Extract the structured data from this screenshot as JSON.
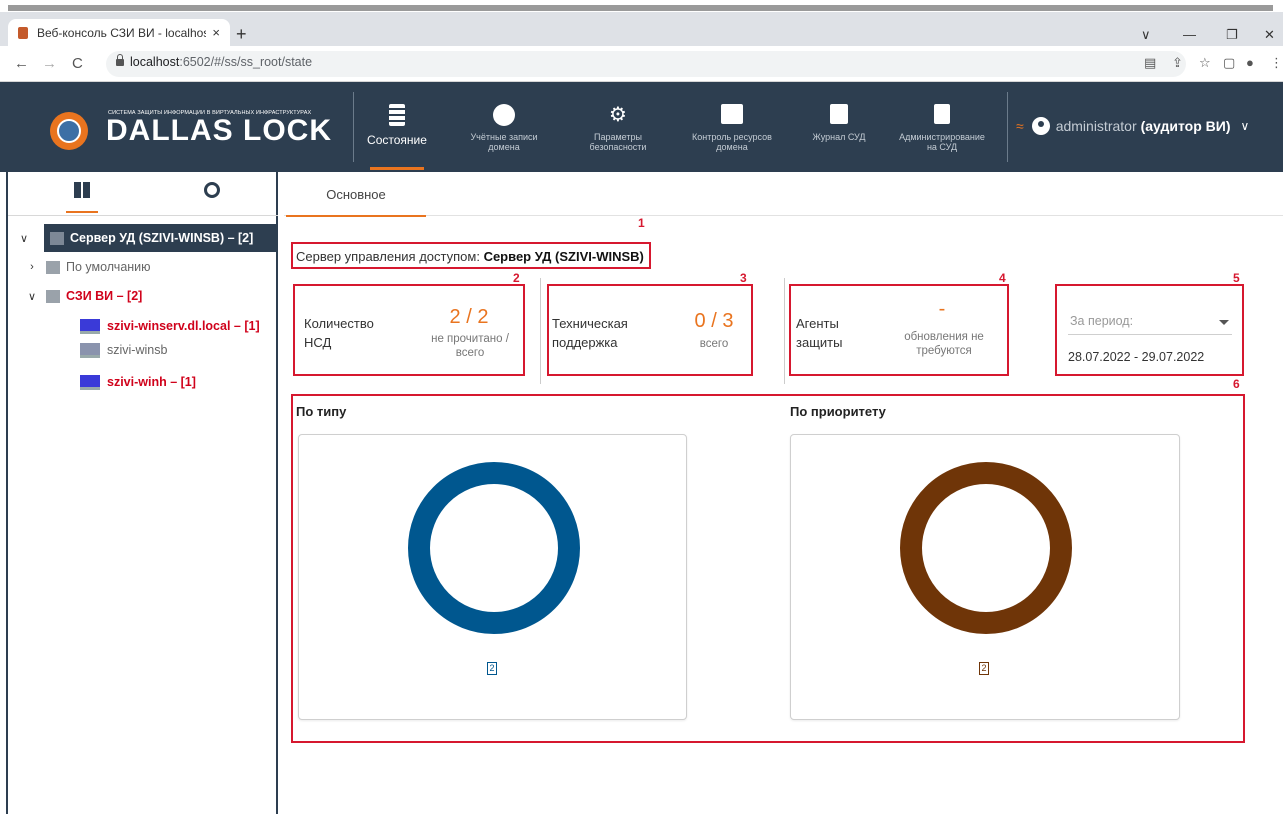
{
  "browser": {
    "tab_title": "Веб-консоль СЗИ ВИ - localhost",
    "tab_close": "×",
    "new_tab": "+",
    "url_host": "localhost",
    "url_path": ":6502/#/ss/ss_root/state",
    "back": "←",
    "forward": "→",
    "reload": "C",
    "window_controls": [
      "∨",
      "—",
      "❐",
      "✕"
    ],
    "toolbar_icons": [
      "translate-icon",
      "share-icon",
      "star-icon",
      "sidepanel-icon",
      "profile-icon",
      "menu-icon"
    ]
  },
  "app": {
    "logo_subtitle": "СИСТЕМА ЗАЩИТЫ ИНФОРМАЦИИ В ВИРТУАЛЬНЫХ ИНФРАСТРУКТУРАХ",
    "logo_title": "DALLAS LOCK",
    "nav": [
      {
        "label": "Состояние",
        "icon": "server-icon",
        "active": true
      },
      {
        "label": "Учётные записи домена",
        "icon": "user-circle-icon",
        "active": false
      },
      {
        "label": "Параметры безопасности",
        "icon": "gear-icon",
        "active": false
      },
      {
        "label": "Контроль ресурсов домена",
        "icon": "resources-icon",
        "active": false
      },
      {
        "label": "Журнал СУД",
        "icon": "journal-icon",
        "active": false
      },
      {
        "label": "Администрирование на СУД",
        "icon": "admin-icon",
        "active": false
      }
    ],
    "user_name": "administrator",
    "user_role": "(аудитор ВИ)",
    "accent_color": "#e9741f",
    "header_color": "#2d3e50"
  },
  "sidebar": {
    "tree": {
      "root": "Сервер УД (SZIVI-WINSB) – [2]",
      "groups": [
        {
          "label": "По умолчанию",
          "expanded": false
        },
        {
          "label": "СЗИ ВИ – [2]",
          "expanded": true,
          "children": [
            "szivi-winserv.dl.local – [1]",
            "szivi-winsb",
            "szivi-winh – [1]"
          ]
        }
      ]
    }
  },
  "main": {
    "tab": "Основное",
    "markers": [
      "1",
      "2",
      "3",
      "4",
      "5",
      "6"
    ],
    "server_label": "Сервер управления доступом:",
    "server_value": "Сервер УД (SZIVI-WINSB)",
    "cards": {
      "nsd_label": "Количество НСД",
      "nsd_value": "2 / 2",
      "nsd_sub": "не прочитано / всего",
      "support_label": "Техническая поддержка",
      "support_value": "0 / 3",
      "support_sub": "всего",
      "agents_label": "Агенты защиты",
      "agents_value": "-",
      "agents_sub": "обновления не требуются"
    },
    "period_placeholder": "За период:",
    "period_value": "28.07.2022 - 29.07.2022",
    "by_type_title": "По типу",
    "by_priority_title": "По приоритету",
    "by_type_legend": "2",
    "by_priority_legend": "2",
    "by_type_color": "#00578f",
    "by_priority_color": "#6f3508"
  }
}
